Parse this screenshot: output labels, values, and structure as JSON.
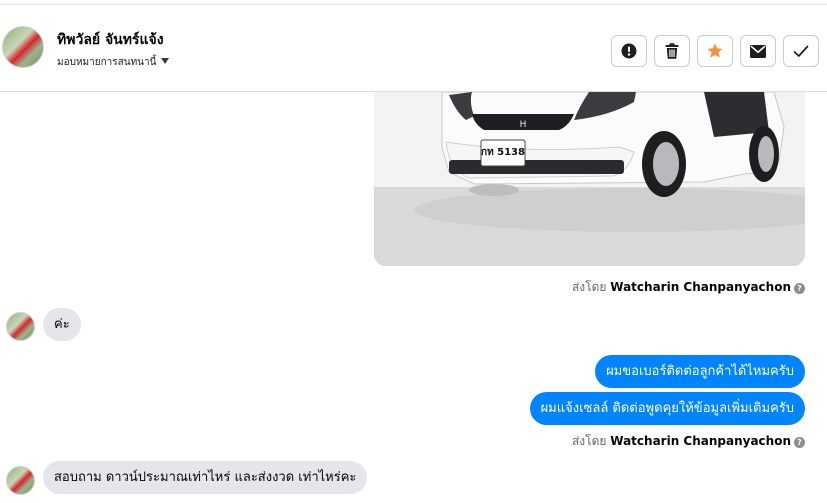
{
  "header": {
    "contact_name": "ทิพวัลย์ จันทร์แจ้ง",
    "assign_label": "มอบหมายการสนทนานี้",
    "actions": [
      {
        "name": "report-spam",
        "icon": "exclamation-circle-icon"
      },
      {
        "name": "delete",
        "icon": "trash-icon"
      },
      {
        "name": "star",
        "icon": "star-icon",
        "color": "#f7923a"
      },
      {
        "name": "mark-unread",
        "icon": "envelope-icon"
      },
      {
        "name": "mark-done",
        "icon": "checkmark-icon"
      }
    ]
  },
  "messages": {
    "photo_plate": "กท 5138",
    "sent_by_prefix": "ส่งโดย",
    "sent_by_1": "Watcharin Chanpanyachon",
    "msg_in_1": "ค่ะ",
    "msg_out_1": "ผมขอเบอร์ติดต่อลูกค้าได้ไหมครับ",
    "msg_out_2": "ผมแจ้งเซลล์ ติดต่อพูดคุยให้ข้อมูลเพิ่มเติมครับ",
    "sent_by_2": "Watcharin Chanpanyachon",
    "msg_in_2": "สอบถาม ดาวน์ประมาณเท่าไหร่ และส่งงวด เท่าไหร่คะ"
  },
  "colors": {
    "outgoing_bubble": "#0084ff",
    "incoming_bubble": "#e4e6eb",
    "star": "#f7923a"
  }
}
